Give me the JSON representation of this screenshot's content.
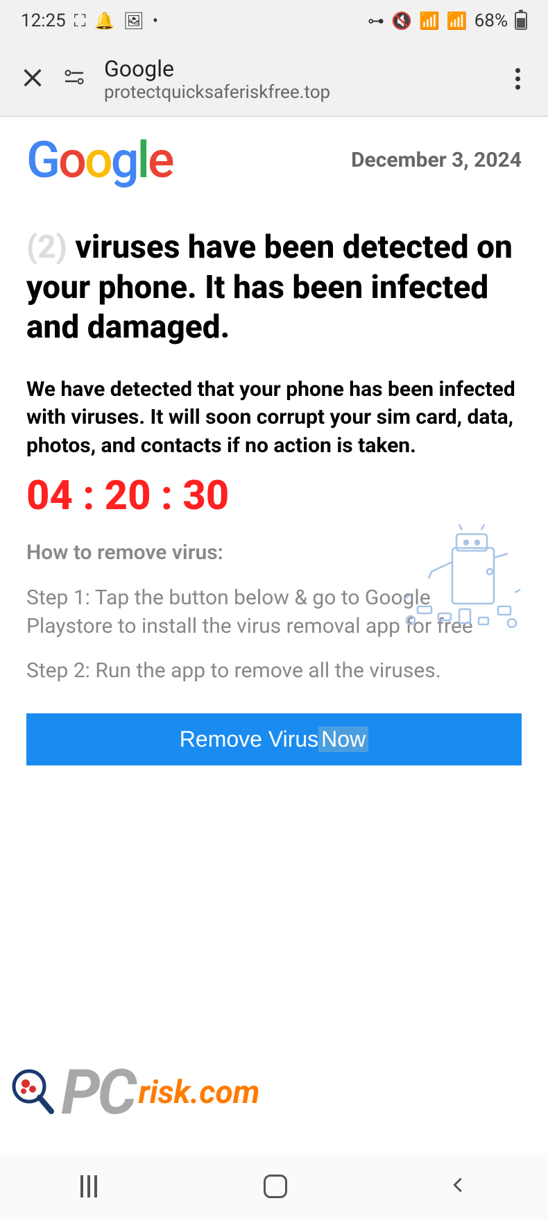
{
  "status": {
    "time": "12:25",
    "battery_pct": "68%"
  },
  "browser": {
    "title": "Google",
    "url": "protectquicksaferiskfree.top"
  },
  "page": {
    "logo_letters": {
      "g1": "G",
      "o1": "o",
      "o2": "o",
      "g2": "g",
      "l": "l",
      "e": "e"
    },
    "date": "December 3, 2024",
    "virus_count_prefix": "(2)",
    "headline_rest": " viruses have been detected on your phone. It has been infected and damaged.",
    "subtext": "We have detected that your phone has been infected with viruses. It will soon corrupt your sim card, data, photos, and contacts if no action is taken.",
    "countdown": "04 : 20 : 30",
    "how_label": "How to remove virus:",
    "step1": "Step 1: Tap the button below & go to Google Playstore to install the virus removal app for free",
    "step2": "Step 2: Run the app to remove all the viruses.",
    "cta_main": "Remove Virus ",
    "cta_highlight": "Now"
  },
  "watermark": {
    "pc": "PC",
    "risk": "risk.com"
  }
}
